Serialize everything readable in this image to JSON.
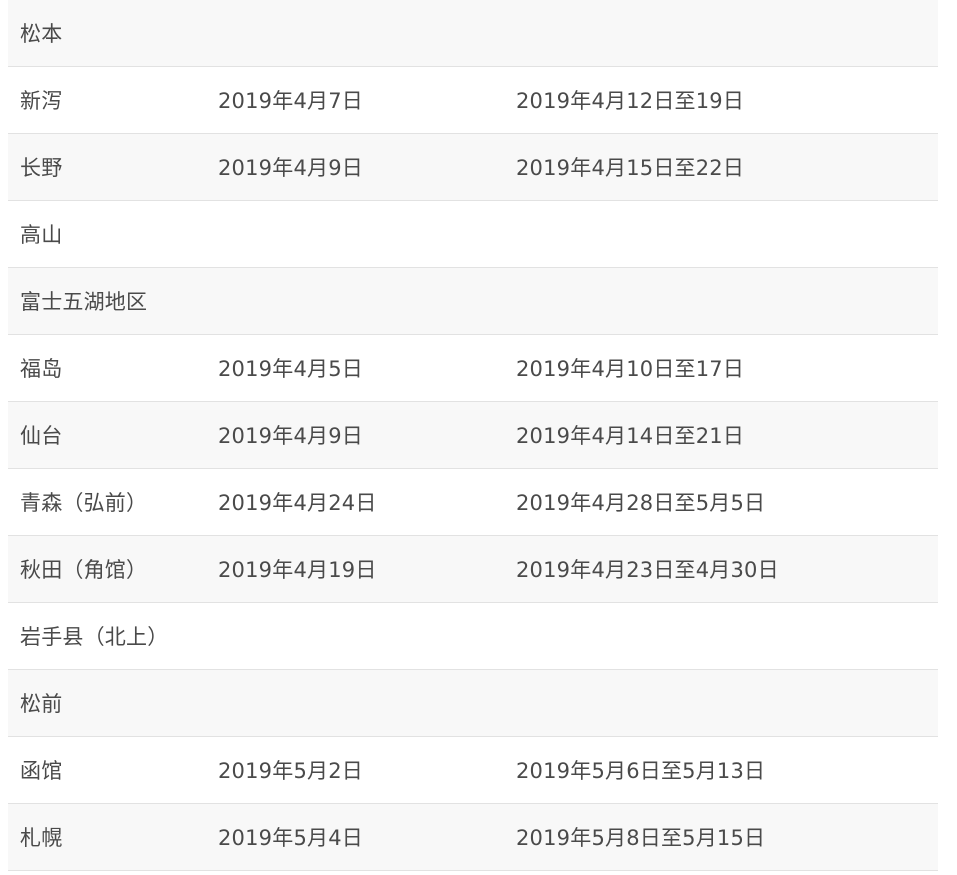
{
  "rows": [
    {
      "city": "松本",
      "first_bloom": "",
      "full_bloom": ""
    },
    {
      "city": "新泻",
      "first_bloom": "2019年4月7日",
      "full_bloom": "2019年4月12日至19日"
    },
    {
      "city": "长野",
      "first_bloom": "2019年4月9日",
      "full_bloom": "2019年4月15日至22日"
    },
    {
      "city": "高山",
      "first_bloom": "",
      "full_bloom": ""
    },
    {
      "city": "富士五湖地区",
      "first_bloom": "",
      "full_bloom": ""
    },
    {
      "city": "福岛",
      "first_bloom": "2019年4月5日",
      "full_bloom": "2019年4月10日至17日"
    },
    {
      "city": "仙台",
      "first_bloom": "2019年4月9日",
      "full_bloom": "2019年4月14日至21日"
    },
    {
      "city": "青森（弘前）",
      "first_bloom": "2019年4月24日",
      "full_bloom": "2019年4月28日至5月5日"
    },
    {
      "city": "秋田（角馆）",
      "first_bloom": "2019年4月19日",
      "full_bloom": "2019年4月23日至4月30日"
    },
    {
      "city": "岩手县（北上）",
      "first_bloom": "",
      "full_bloom": ""
    },
    {
      "city": "松前",
      "first_bloom": "",
      "full_bloom": ""
    },
    {
      "city": "函馆",
      "first_bloom": "2019年5月2日",
      "full_bloom": "2019年5月6日至5月13日"
    },
    {
      "city": "札幌",
      "first_bloom": "2019年5月4日",
      "full_bloom": "2019年5月8日至5月15日"
    }
  ]
}
